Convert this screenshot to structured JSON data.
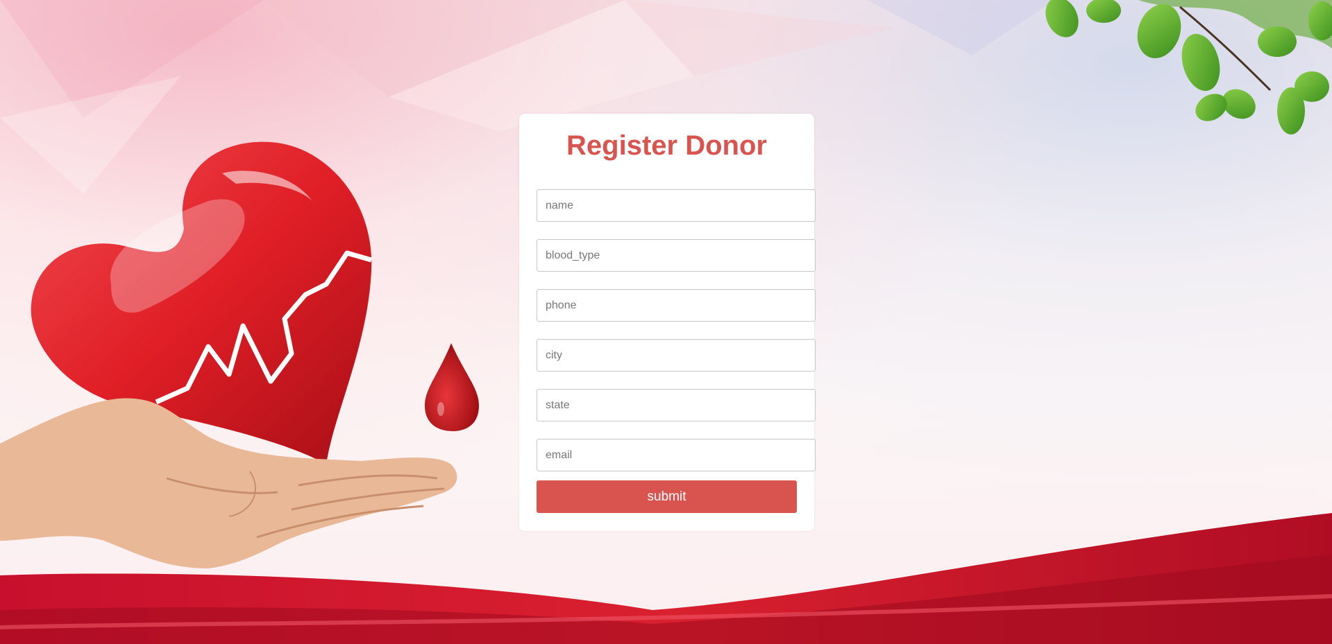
{
  "form": {
    "title": "Register Donor",
    "fields": [
      {
        "name": "name",
        "placeholder": "name",
        "value": ""
      },
      {
        "name": "blood_type",
        "placeholder": "blood_type",
        "value": ""
      },
      {
        "name": "phone",
        "placeholder": "phone",
        "value": ""
      },
      {
        "name": "city",
        "placeholder": "city",
        "value": ""
      },
      {
        "name": "state",
        "placeholder": "state",
        "value": ""
      },
      {
        "name": "email",
        "placeholder": "email",
        "value": ""
      }
    ],
    "submit_label": "submit"
  },
  "background": {
    "illustration": [
      "heart-icon",
      "hand-illustration",
      "blood-drop-icon",
      "leaves-decoration",
      "red-ribbon"
    ]
  },
  "colors": {
    "accent": "#d9534f",
    "heart": "#e01e26",
    "ribbon": "#c8102e"
  }
}
